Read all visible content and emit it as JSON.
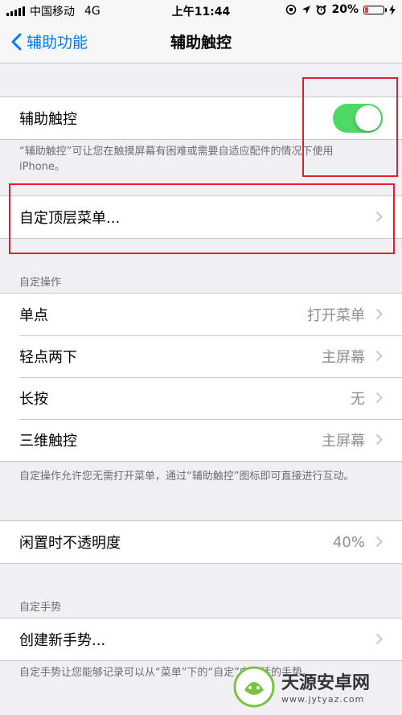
{
  "status_bar": {
    "carrier": "中国移动",
    "network": "4G",
    "time": "上午11:44",
    "battery": "20%",
    "battery_level": 0.2
  },
  "nav": {
    "back_label": "辅助功能",
    "title": "辅助触控"
  },
  "assistive_touch": {
    "label": "辅助触控",
    "enabled": true,
    "footer": "“辅助触控”可让您在触摸屏幕有困难或需要自适应配件的情况下使用 iPhone。"
  },
  "customize_menu": {
    "label": "自定顶层菜单..."
  },
  "custom_actions": {
    "header": "自定操作",
    "items": [
      {
        "label": "单点",
        "value": "打开菜单"
      },
      {
        "label": "轻点两下",
        "value": "主屏幕"
      },
      {
        "label": "长按",
        "value": "无"
      },
      {
        "label": "三维触控",
        "value": "主屏幕"
      }
    ],
    "footer": "自定操作允许您无需打开菜单，通过“辅助触控”图标即可直接进行互动。"
  },
  "idle_opacity": {
    "label": "闲置时不透明度",
    "value": "40%"
  },
  "custom_gestures": {
    "header": "自定手势",
    "create_label": "创建新手势...",
    "footer": "自定手势让您能够记录可以从“菜单”下的“自定”中激活的手势。"
  },
  "watermark": {
    "title": "天源安卓网",
    "url": "www.jytyaz.com"
  },
  "colors": {
    "accent": "#007aff",
    "toggle_on": "#4cd964",
    "highlight": "#e0202e"
  }
}
